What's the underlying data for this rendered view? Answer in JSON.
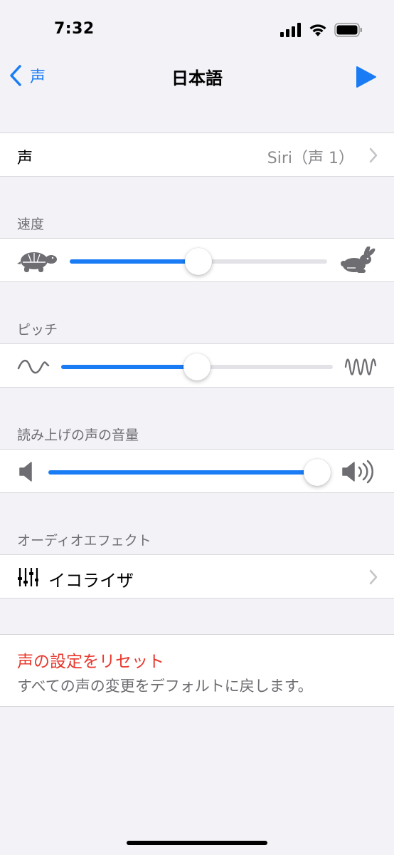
{
  "status": {
    "time": "7:32"
  },
  "nav": {
    "back_label": "声",
    "title": "日本語"
  },
  "voice_row": {
    "label": "声",
    "value": "Siri（声 1）"
  },
  "speed": {
    "header": "速度",
    "value": 0.5
  },
  "pitch": {
    "header": "ピッチ",
    "value": 0.5
  },
  "volume": {
    "header": "読み上げの声の音量",
    "value": 1.0
  },
  "audio_effects": {
    "header": "オーディオエフェクト",
    "equalizer_label": "イコライザ"
  },
  "reset": {
    "title": "声の設定をリセット",
    "description": "すべての声の変更をデフォルトに戻します。"
  },
  "colors": {
    "accent": "#1a7cf5",
    "destructive": "#e8382d",
    "secondary_text": "#8a8a8e",
    "icon_gray": "#6d6d72"
  }
}
